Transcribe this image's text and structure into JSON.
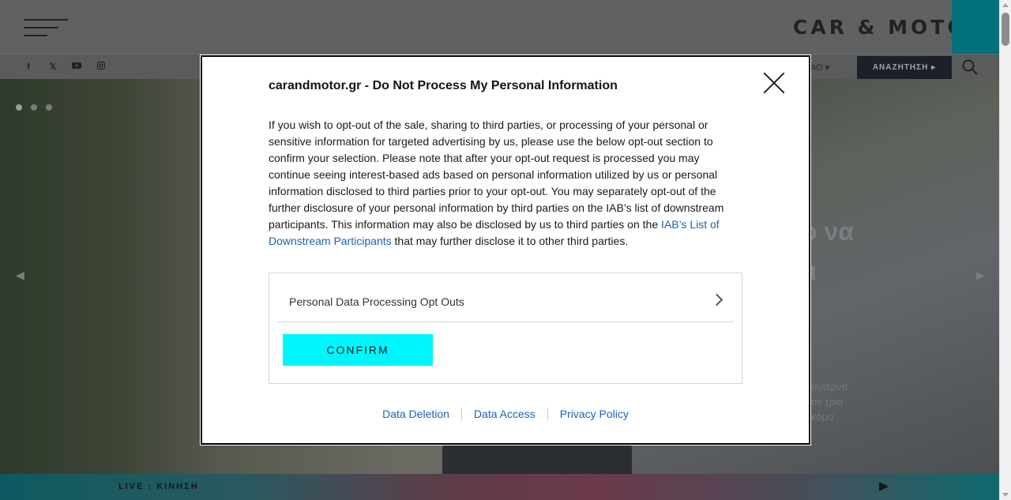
{
  "site": {
    "logo": "CAR & MOTOR.",
    "social_icons": [
      "facebook-icon",
      "x-icon",
      "youtube-icon",
      "instagram-icon"
    ],
    "language_partial": "ΑΟ",
    "search_label": "ΑΝΑΖΗΤΗΣΗ",
    "hero_title_fragment_1": "ο να",
    "hero_title_fragment_2": "ι",
    "hero_text_fragment": "οντέρνα σε τρία κόμα",
    "live_label": "LIVE : ΚΙΝΗΣΗ"
  },
  "modal": {
    "title": "carandmotor.gr - Do Not Process My Personal Information",
    "body_text": "If you wish to opt-out of the sale, sharing to third parties, or processing of your personal or sensitive information for targeted advertising by us, please use the below opt-out section to confirm your selection. Please note that after your opt-out request is processed you may continue seeing interest-based ads based on personal information utilized by us or personal information disclosed to third parties prior to your opt-out. You may separately opt-out of the further disclosure of your personal information by third parties on the IAB’s list of downstream participants. This information may also be disclosed by us to third parties on the",
    "body_link": "IAB’s List of Downstream Participants",
    "body_tail": " that may further disclose it to other third parties.",
    "opt_out_label": "Personal Data Processing Opt Outs",
    "confirm_label": "CONFIRM",
    "footer_links": [
      "Data Deletion",
      "Data Access",
      "Privacy Policy"
    ]
  },
  "colors": {
    "confirm_bg": "#00f6ff",
    "link": "#1a63b8",
    "brand_teal": "#00707a"
  }
}
